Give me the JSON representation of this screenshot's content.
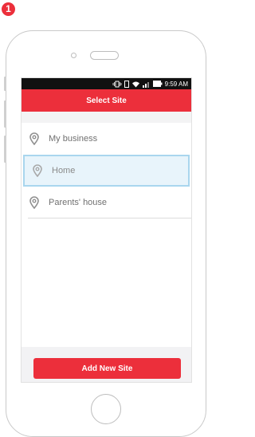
{
  "step_badge": "1",
  "status_bar": {
    "time": "9:59 AM"
  },
  "app_bar": {
    "title": "Select Site"
  },
  "sites": [
    {
      "label": "My business",
      "selected": false
    },
    {
      "label": "Home",
      "selected": true
    },
    {
      "label": "Parents' house",
      "selected": false
    }
  ],
  "actions": {
    "add_site_label": "Add New Site"
  },
  "colors": {
    "accent": "#ec2f3b",
    "selected_bg": "#e8f4fb",
    "selected_border": "#a9d6ee"
  },
  "icons": [
    "location-pin-icon",
    "wifi-icon",
    "signal-icon",
    "battery-icon",
    "vibrate-icon"
  ]
}
